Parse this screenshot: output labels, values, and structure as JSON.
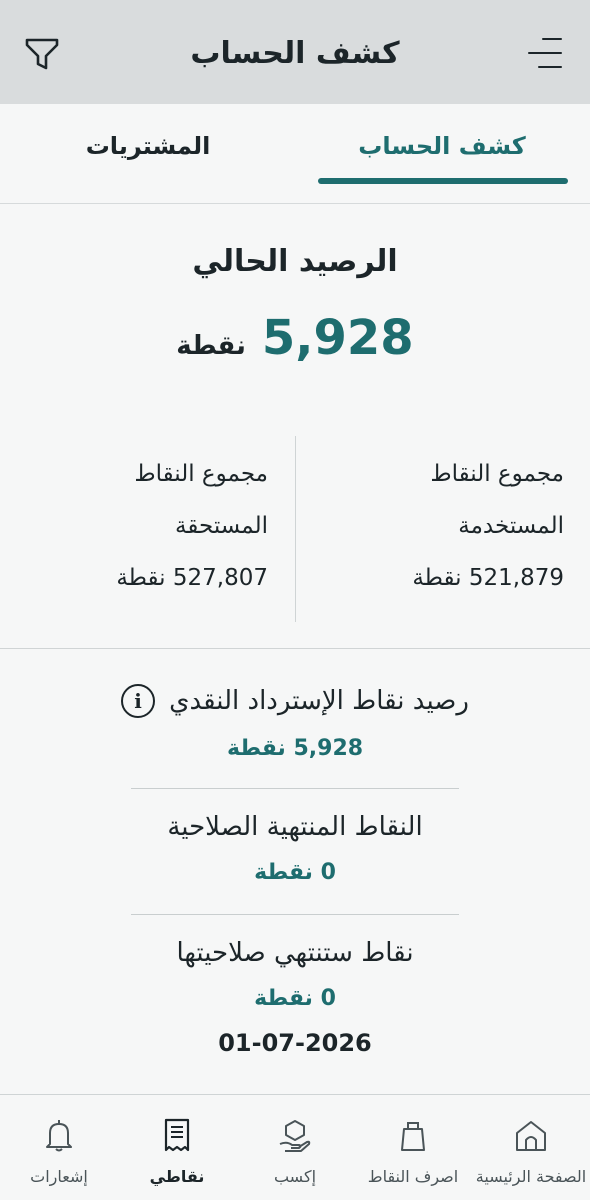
{
  "header": {
    "title": "كشف الحساب",
    "menu_icon": "menu-icon",
    "filter_icon": "filter-icon"
  },
  "tabs": [
    {
      "label": "كشف الحساب",
      "active": true
    },
    {
      "label": "المشتريات",
      "active": false
    }
  ],
  "balance": {
    "title": "الرصيد الحالي",
    "value": "5,928",
    "unit": "نقطة"
  },
  "stats": {
    "used": {
      "label_line1": "مجموع النقاط",
      "label_line2": "المستخدمة",
      "value": "521,879 نقطة"
    },
    "earned": {
      "label_line1": "مجموع النقاط",
      "label_line2": "المستحقة",
      "value": "527,807 نقطة"
    }
  },
  "cashback": {
    "label": "رصيد نقاط الإسترداد النقدي",
    "value": "5,928 نقطة",
    "icon": "info-icon"
  },
  "expired": {
    "label": "النقاط المنتهية الصلاحية",
    "value": "0 نقطة"
  },
  "expiring": {
    "label": "نقاط ستنتهي صلاحيتها",
    "value": "0 نقطة",
    "date": "01-07-2026"
  },
  "bottom_nav": [
    {
      "label": "الصفحة الرئيسية",
      "icon": "home-icon",
      "active": false
    },
    {
      "label": "اصرف النقاط",
      "icon": "shopping-bag-icon",
      "active": false
    },
    {
      "label": "إكسب",
      "icon": "earn-hand-icon",
      "active": false
    },
    {
      "label": "نقاطي",
      "icon": "receipt-icon",
      "active": true
    },
    {
      "label": "إشعارات",
      "icon": "bell-icon",
      "active": false
    }
  ],
  "colors": {
    "accent": "#1e6d6f",
    "header_bg": "#d9dcdd",
    "text": "#1c2529"
  }
}
